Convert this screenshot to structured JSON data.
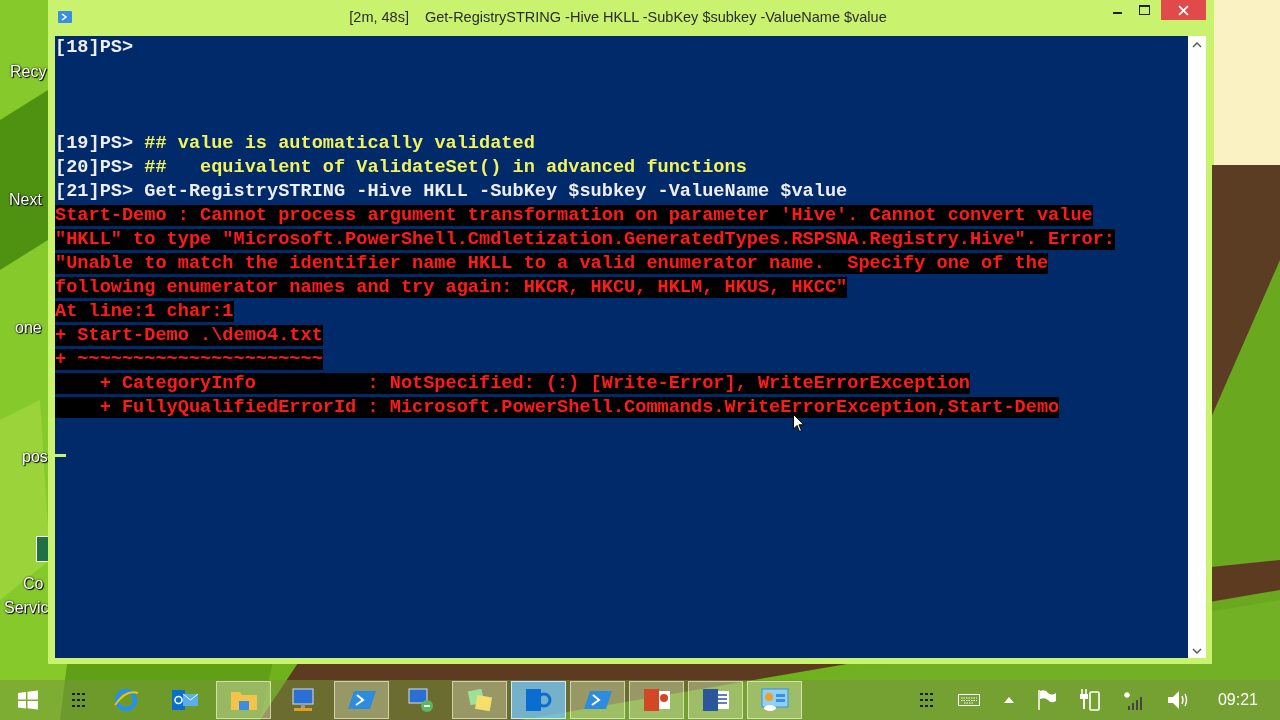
{
  "desktop": {
    "labels": [
      "Recy",
      "Next",
      "one",
      "pos",
      "Co",
      "Servic"
    ]
  },
  "window": {
    "timer": "[2m, 48s]",
    "title": "Get-RegistrySTRING -Hive HKLL -SubKey $subkey -ValueName $value"
  },
  "console": {
    "lines": [
      {
        "kind": "prompt",
        "prompt": "[18]PS>"
      },
      {
        "kind": "blank"
      },
      {
        "kind": "blank"
      },
      {
        "kind": "blank"
      },
      {
        "kind": "comment",
        "prompt": "[19]PS>",
        "text": "## value is automatically validated"
      },
      {
        "kind": "comment",
        "prompt": "[20]PS>",
        "text": "##   equivalent of ValidateSet() in advanced functions"
      },
      {
        "kind": "command",
        "prompt": "[21]PS>",
        "text": "Get-RegistrySTRING -Hive HKLL -SubKey $subkey -ValueName $value"
      },
      {
        "kind": "error",
        "text": "Start-Demo : Cannot process argument transformation on parameter 'Hive'. Cannot convert value"
      },
      {
        "kind": "error",
        "text": "\"HKLL\" to type \"Microsoft.PowerShell.Cmdletization.GeneratedTypes.RSPSNA.Registry.Hive\". Error:"
      },
      {
        "kind": "error",
        "text": "\"Unable to match the identifier name HKLL to a valid enumerator name.  Specify one of the"
      },
      {
        "kind": "error",
        "text": "following enumerator names and try again: HKCR, HKCU, HKLM, HKUS, HKCC\""
      },
      {
        "kind": "error",
        "text": "At line:1 char:1"
      },
      {
        "kind": "error",
        "text": "+ Start-Demo .\\demo4.txt"
      },
      {
        "kind": "error",
        "text": "+ ~~~~~~~~~~~~~~~~~~~~~~"
      },
      {
        "kind": "error",
        "text": "    + CategoryInfo          : NotSpecified: (:) [Write-Error], WriteErrorException"
      },
      {
        "kind": "error",
        "text": "    + FullyQualifiedErrorId : Microsoft.PowerShell.Commands.WriteErrorException,Start-Demo"
      },
      {
        "kind": "blank"
      },
      {
        "kind": "cursor"
      }
    ]
  },
  "taskbar": {
    "items": [
      {
        "kind": "browser",
        "running": false,
        "selected": false
      },
      {
        "kind": "mail",
        "running": false,
        "selected": false
      },
      {
        "kind": "folder",
        "running": true,
        "selected": false
      },
      {
        "kind": "computer",
        "running": false,
        "selected": false
      },
      {
        "kind": "shell",
        "running": true,
        "selected": false
      },
      {
        "kind": "remote",
        "running": false,
        "selected": false
      },
      {
        "kind": "notes",
        "running": true,
        "selected": false
      },
      {
        "kind": "chat",
        "running": true,
        "selected": true
      },
      {
        "kind": "shell",
        "running": true,
        "selected": false
      },
      {
        "kind": "slides",
        "running": true,
        "selected": false
      },
      {
        "kind": "document",
        "running": true,
        "selected": false
      },
      {
        "kind": "panel",
        "running": true,
        "selected": false
      }
    ],
    "clock": "09:21"
  }
}
